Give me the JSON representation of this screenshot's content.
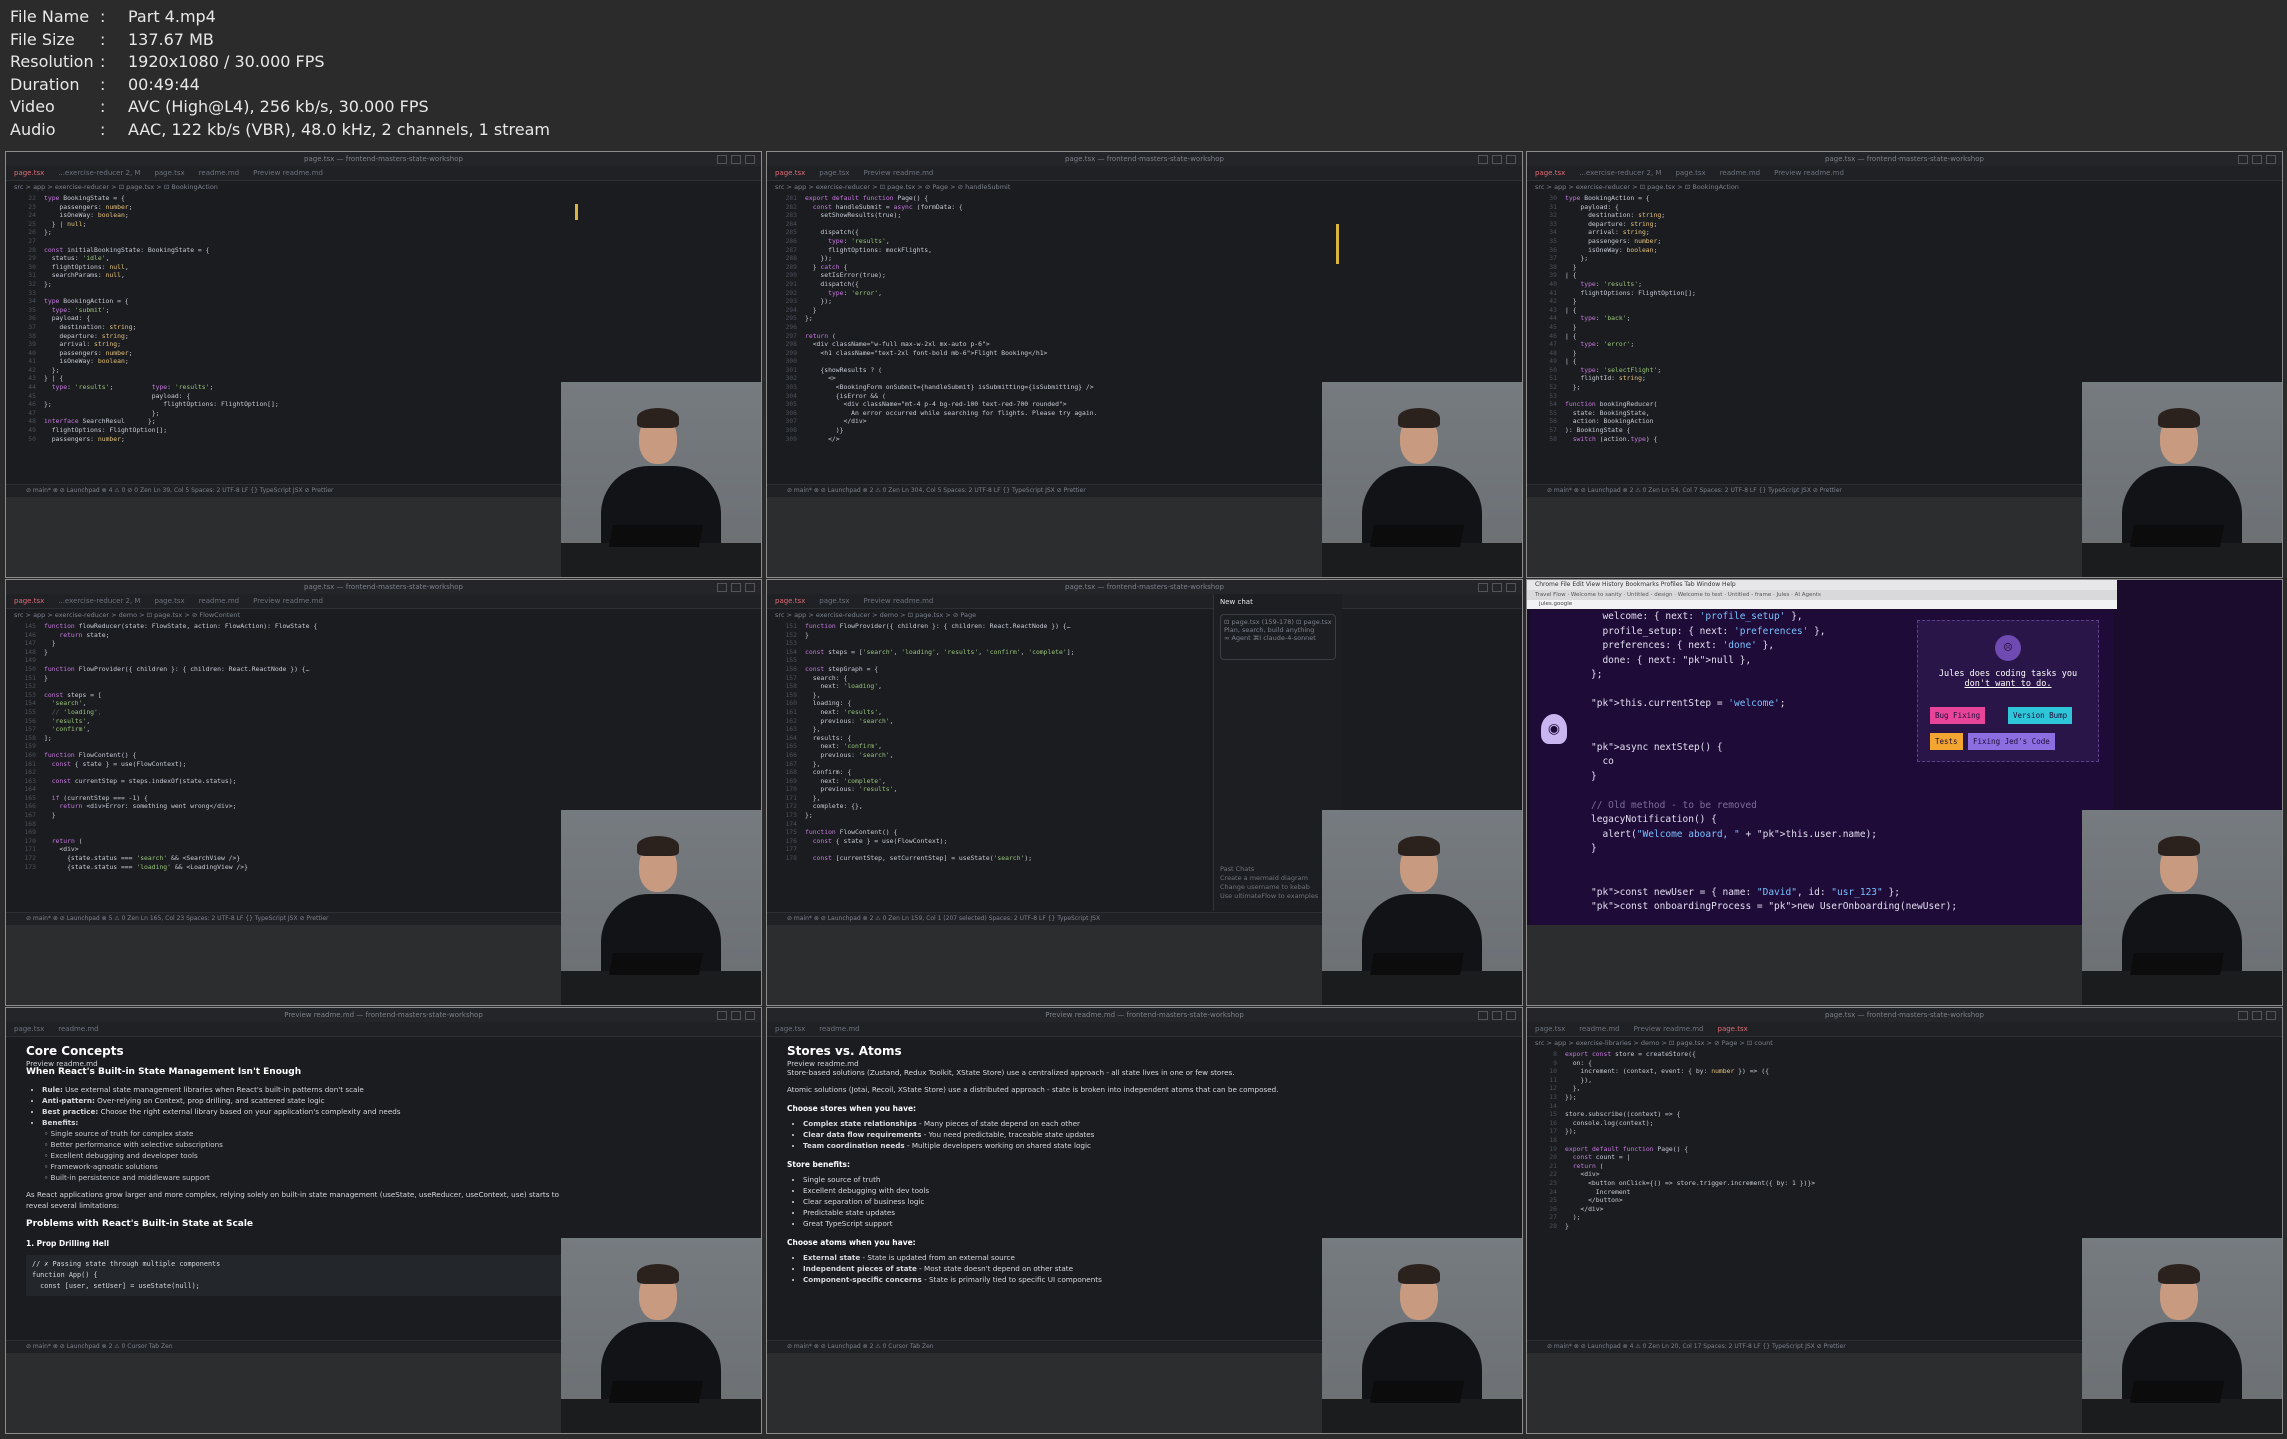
{
  "meta": [
    {
      "key": "File Name",
      "value": "Part 4.mp4"
    },
    {
      "key": "File Size",
      "value": "137.67 MB"
    },
    {
      "key": "Resolution",
      "value": "1920x1080 / 30.000 FPS"
    },
    {
      "key": "Duration",
      "value": "00:49:44"
    },
    {
      "key": "Video",
      "value": "AVC (High@L4), 256 kb/s, 30.000 FPS"
    },
    {
      "key": "Audio",
      "value": "AAC, 122 kb/s (VBR), 48.0 kHz, 2 channels, 1 stream"
    }
  ],
  "window_title": "page.tsx — frontend-masters-state-workshop",
  "preview_title": "Preview readme.md — frontend-masters-state-workshop",
  "tile1": {
    "tabs": [
      "page.tsx",
      "...exercise-reducer 2, M",
      "page.tsx",
      "readme.md",
      "Preview readme.md"
    ],
    "breadcrumb": "src > app > exercise-reducer > ⊡ page.tsx > ⊡ BookingAction",
    "lines": [
      "type BookingState = {",
      "    passengers: number;",
      "    isOneWay: boolean;",
      "  } | null;",
      "};",
      "",
      "const initialBookingState: BookingState = {",
      "  status: 'idle',",
      "  flightOptions: null,",
      "  searchParams: null,",
      "};",
      "",
      "type BookingAction = {",
      "  type: 'submit';",
      "  payload: {",
      "    destination: string;",
      "    departure: string;",
      "    arrival: string;",
      "    passengers: number;",
      "    isOneWay: boolean;",
      "  };",
      "} | {",
      "  type: 'results';          type: 'results';",
      "                            payload: {",
      "};                             flightOptions: FlightOption[];",
      "                            };",
      "interface SearchResul      };",
      "  flightOptions: FlightOption[];",
      "  passengers: number;"
    ],
    "status": "⊘ main*  ⊗ ⊘  Launchpad  ⊗ 4 ⚠ 0  ⊘ 0        Zen     Ln 39, Col 5   Spaces: 2   UTF-8   LF   {} TypeScript JSX   ⊘ Prettier"
  },
  "tile2": {
    "breadcrumb": "src > app > exercise-reducer > ⊡ page.tsx > ⊘ Page > ⊘ handleSubmit",
    "lines": [
      "export default function Page() {",
      "  const handleSubmit = async (formData: {",
      "    setShowResults(true);",
      "",
      "    dispatch({",
      "      type: 'results',",
      "      flightOptions: mockFlights,",
      "    });",
      "  } catch {",
      "    setIsError(true);",
      "    dispatch({",
      "      type: 'error',",
      "    });",
      "  }",
      "};",
      "",
      "return (",
      "  <div className=\"w-full max-w-2xl mx-auto p-6\">",
      "    <h1 className=\"text-2xl font-bold mb-6\">Flight Booking</h1>",
      "",
      "    {showResults ? (",
      "      <>",
      "        <BookingForm onSubmit={handleSubmit} isSubmitting={isSubmitting} />",
      "        {isError && (",
      "          <div className=\"mt-4 p-4 bg-red-100 text-red-700 rounded\">",
      "            An error occurred while searching for flights. Please try again.",
      "          </div>",
      "        )}",
      "      </>"
    ],
    "status": "⊘ main*  ⊗ ⊘  Launchpad  ⊗ 2 ⚠ 0        Zen     Ln 304, Col 5   Spaces: 2   UTF-8   LF   {} TypeScript JSX   ⊘ Prettier"
  },
  "tile3": {
    "breadcrumb": "src > app > exercise-reducer > ⊡ page.tsx > ⊡ BookingAction",
    "lines": [
      "type BookingAction = {",
      "    payload: {",
      "      destination: string;",
      "      departure: string;",
      "      arrival: string;",
      "      passengers: number;",
      "      isOneWay: boolean;",
      "    };",
      "  }",
      "| {",
      "    type: 'results';",
      "    flightOptions: FlightOption[];",
      "  }",
      "| {",
      "    type: 'back';",
      "  }",
      "| {",
      "    type: 'error';",
      "  }",
      "| {",
      "    type: 'selectFlight';",
      "    flightId: string;",
      "  };",
      "",
      "function bookingReducer(",
      "  state: BookingState,",
      "  action: BookingAction",
      "): BookingState {",
      "  switch (action.type) {"
    ],
    "status": "⊘ main*  ⊗ ⊘  Launchpad  ⊗ 2 ⚠ 0        Zen     Ln 54, Col 7   Spaces: 2   UTF-8   LF   {} TypeScript JSX   ⊘ Prettier"
  },
  "tile4": {
    "breadcrumb": "src > app > exercise-reducer > demo > ⊡ page.tsx > ⊘ FlowContent",
    "lines": [
      "function flowReducer(state: FlowState, action: FlowAction): FlowState {",
      "    return state;",
      "  }",
      "}",
      "",
      "function FlowProvider({ children }: { children: React.ReactNode }) {…",
      "}",
      "",
      "const steps = [",
      "  'search',",
      "  // 'loading',",
      "  'results',",
      "  'confirm',",
      "];",
      "",
      "function FlowContent() {",
      "  const { state } = use(FlowContext);",
      "",
      "  const currentStep = steps.indexOf(state.status);",
      "",
      "  if (currentStep === -1) {",
      "    return <div>Error: something went wrong</div>;",
      "  }",
      "",
      "",
      "  return (",
      "    <div>",
      "      {state.status === 'search' && <SearchView />}",
      "      {state.status === 'loading' && <LoadingView />}"
    ],
    "status": "⊘ main*  ⊗ ⊘  Launchpad  ⊗ 5 ⚠ 0        Zen     Ln 165, Col 23   Spaces: 2   UTF-8   LF   {} TypeScript JSX   ⊘ Prettier"
  },
  "tile5": {
    "breadcrumb": "src > app > exercise-reducer > demo > ⊡ page.tsx > ⊘ Page",
    "lines": [
      "function FlowProvider({ children }: { children: React.ReactNode }) {…",
      "}",
      "",
      "const steps = ['search', 'loading', 'results', 'confirm', 'complete'];",
      "",
      "const stepGraph = {",
      "  search: {",
      "    next: 'loading',",
      "  },",
      "  loading: {",
      "    next: 'results',",
      "    previous: 'search',",
      "  },",
      "  results: {",
      "    next: 'confirm',",
      "    previous: 'search',",
      "  },",
      "  confirm: {",
      "    next: 'complete',",
      "    previous: 'results',",
      "  },",
      "  complete: {},",
      "};",
      "",
      "function FlowContent() {",
      "  const { state } = use(FlowContext);",
      "",
      "  const [currentStep, setCurrentStep] = useState('search');"
    ],
    "chat": {
      "title": "New chat",
      "context": "⊡ page.tsx (159-178)   ⊡ page.tsx",
      "placeholder": "Plan, search, build anything",
      "agent": "∞ Agent ⌘I   claude-4-sonnet",
      "past": [
        "Past Chats",
        "Create a mermaid diagram",
        "Change username to kebab",
        "Use ultimateFlow to examples"
      ]
    },
    "status": "⊘ main*  ⊗ ⊘  Launchpad  ⊗ 2 ⚠ 0        Zen     Ln 159, Col 1 (207 selected)   Spaces: 2   UTF-8   LF   {} TypeScript JSX"
  },
  "tile6": {
    "menubar": " Chrome  File  Edit  View  History  Bookmarks  Profiles  Tab  Window  Help",
    "tabs": "Travel Flow · Welcome to sanity · Untitled - design · Welcome to test · Untitled - frame · Jules · AI Agents",
    "url": "jules.google",
    "lines": [
      "  welcome: { next: 'profile_setup' },",
      "  profile_setup: { next: 'preferences' },",
      "  preferences: { next: 'done' },",
      "  done: { next: null },",
      "};",
      "",
      "this.currentStep = 'welcome';",
      "",
      "",
      "async nextStep() {",
      "  co",
      "}",
      "",
      "// Old method - to be removed",
      "legacyNotification() {",
      "  alert(\"Welcome aboard, \" + this.user.name);",
      "}",
      "",
      "",
      "const newUser = { name: \"David\", id: \"usr_123\" };",
      "const onboardingProcess = new UserOnboarding(newUser);"
    ],
    "card": {
      "line1": "Jules does coding tasks you",
      "line2": "don't want to do.",
      "buttons": [
        "Bug Fixing",
        "Version Bump",
        "Tests",
        "Fixing Jed's Code"
      ]
    }
  },
  "tile7": {
    "tabs": [
      "page.tsx",
      "readme.md",
      "Preview readme.md"
    ],
    "h1": "Core Concepts",
    "h2": "When React's Built-in State Management Isn't Enough",
    "bullets": [
      {
        "b": "Rule:",
        "t": " Use external state management libraries when React's built-in patterns don't scale"
      },
      {
        "b": "Anti-pattern:",
        "t": " Over-relying on Context, prop drilling, and scattered state logic"
      },
      {
        "b": "Best practice:",
        "t": " Choose the right external library based on your application's complexity and needs"
      },
      {
        "b": "Benefits:",
        "t": ""
      }
    ],
    "benefits": [
      "Single source of truth for complex state",
      "Better performance with selective subscriptions",
      "Excellent debugging and developer tools",
      "Framework-agnostic solutions",
      "Built-in persistence and middleware support"
    ],
    "para": "As React applications grow larger and more complex, relying solely on built-in state management (useState, useReducer, useContext, use) starts to reveal several limitations:",
    "h2b": "Problems with React's Built-in State at Scale",
    "h3": "1. Prop Drilling Hell",
    "code": "// ✗ Passing state through multiple components\nfunction App() {\n  const [user, setUser] = useState(null);",
    "status": "⊘ main*  ⊗ ⊘  Launchpad  ⊗ 2 ⚠ 0                                  Cursor Tab   Zen"
  },
  "tile8": {
    "tabs": [
      "page.tsx",
      "readme.md",
      "Preview readme.md"
    ],
    "h1": "Stores vs. Atoms",
    "p1": "Store-based solutions (Zustand, Redux Toolkit, XState Store) use a centralized approach - all state lives in one or few stores.",
    "p2": "Atomic solutions (Jotai, Recoil, XState Store) use a distributed approach - state is broken into independent atoms that can be composed.",
    "h3a": "Choose stores when you have:",
    "storesWhen": [
      "Complex state relationships - Many pieces of state depend on each other",
      "Clear data flow requirements - You need predictable, traceable state updates",
      "Team coordination needs - Multiple developers working on shared state logic"
    ],
    "h3b": "Store benefits:",
    "storeBenefits": [
      "Single source of truth",
      "Excellent debugging with dev tools",
      "Clear separation of business logic",
      "Predictable state updates",
      "Great TypeScript support"
    ],
    "h3c": "Choose atoms when you have:",
    "atomsWhen": [
      "External state - State is updated from an external source",
      "Independent pieces of state - Most state doesn't depend on other state",
      "Component-specific concerns - State is primarily tied to specific UI components"
    ],
    "status": "⊘ main*  ⊗ ⊘  Launchpad  ⊗ 2 ⚠ 0                                  Cursor Tab   Zen"
  },
  "tile9": {
    "breadcrumb": "src > app > exercise-libraries > demo > ⊡ page.tsx > ⊘ Page > ⊡ count",
    "lines": [
      "export const store = createStore({",
      "  on: {",
      "    increment: (context, event: { by: number }) => ({",
      "    }),",
      "  },",
      "});",
      "",
      "store.subscribe((context) => {",
      "  console.log(context);",
      "});",
      "",
      "export default function Page() {",
      "  const count = |",
      "  return (",
      "    <div>",
      "      <button onClick={() => store.trigger.increment({ by: 1 })}>",
      "        Increment",
      "      </button>",
      "    </div>",
      "  );",
      "}"
    ],
    "status": "⊘ main*  ⊗ ⊘  Launchpad  ⊗ 4 ⚠ 0        Zen     Ln 20, Col 17   Spaces: 2   UTF-8   LF   {} TypeScript JSX   ⊘ Prettier"
  }
}
